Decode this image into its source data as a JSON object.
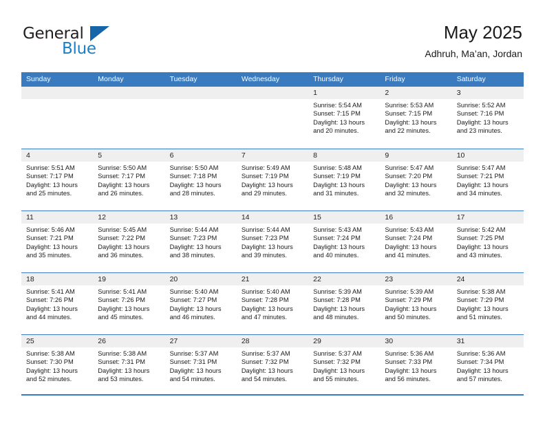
{
  "brand": {
    "name_part1": "General",
    "name_part2": "Blue",
    "flag_color": "#1565a8"
  },
  "header": {
    "title": "May 2025",
    "subtitle": "Adhruh, Ma’an, Jordan"
  },
  "theme": {
    "header_blue": "#3a7bbf",
    "date_strip_gray": "#efefef",
    "text": "#1a1a1a"
  },
  "weekdays": [
    "Sunday",
    "Monday",
    "Tuesday",
    "Wednesday",
    "Thursday",
    "Friday",
    "Saturday"
  ],
  "weeks": [
    [
      {
        "date": "",
        "lines": []
      },
      {
        "date": "",
        "lines": []
      },
      {
        "date": "",
        "lines": []
      },
      {
        "date": "",
        "lines": []
      },
      {
        "date": "1",
        "lines": [
          "Sunrise: 5:54 AM",
          "Sunset: 7:15 PM",
          "Daylight: 13 hours",
          "and 20 minutes."
        ]
      },
      {
        "date": "2",
        "lines": [
          "Sunrise: 5:53 AM",
          "Sunset: 7:15 PM",
          "Daylight: 13 hours",
          "and 22 minutes."
        ]
      },
      {
        "date": "3",
        "lines": [
          "Sunrise: 5:52 AM",
          "Sunset: 7:16 PM",
          "Daylight: 13 hours",
          "and 23 minutes."
        ]
      }
    ],
    [
      {
        "date": "4",
        "lines": [
          "Sunrise: 5:51 AM",
          "Sunset: 7:17 PM",
          "Daylight: 13 hours",
          "and 25 minutes."
        ]
      },
      {
        "date": "5",
        "lines": [
          "Sunrise: 5:50 AM",
          "Sunset: 7:17 PM",
          "Daylight: 13 hours",
          "and 26 minutes."
        ]
      },
      {
        "date": "6",
        "lines": [
          "Sunrise: 5:50 AM",
          "Sunset: 7:18 PM",
          "Daylight: 13 hours",
          "and 28 minutes."
        ]
      },
      {
        "date": "7",
        "lines": [
          "Sunrise: 5:49 AM",
          "Sunset: 7:19 PM",
          "Daylight: 13 hours",
          "and 29 minutes."
        ]
      },
      {
        "date": "8",
        "lines": [
          "Sunrise: 5:48 AM",
          "Sunset: 7:19 PM",
          "Daylight: 13 hours",
          "and 31 minutes."
        ]
      },
      {
        "date": "9",
        "lines": [
          "Sunrise: 5:47 AM",
          "Sunset: 7:20 PM",
          "Daylight: 13 hours",
          "and 32 minutes."
        ]
      },
      {
        "date": "10",
        "lines": [
          "Sunrise: 5:47 AM",
          "Sunset: 7:21 PM",
          "Daylight: 13 hours",
          "and 34 minutes."
        ]
      }
    ],
    [
      {
        "date": "11",
        "lines": [
          "Sunrise: 5:46 AM",
          "Sunset: 7:21 PM",
          "Daylight: 13 hours",
          "and 35 minutes."
        ]
      },
      {
        "date": "12",
        "lines": [
          "Sunrise: 5:45 AM",
          "Sunset: 7:22 PM",
          "Daylight: 13 hours",
          "and 36 minutes."
        ]
      },
      {
        "date": "13",
        "lines": [
          "Sunrise: 5:44 AM",
          "Sunset: 7:23 PM",
          "Daylight: 13 hours",
          "and 38 minutes."
        ]
      },
      {
        "date": "14",
        "lines": [
          "Sunrise: 5:44 AM",
          "Sunset: 7:23 PM",
          "Daylight: 13 hours",
          "and 39 minutes."
        ]
      },
      {
        "date": "15",
        "lines": [
          "Sunrise: 5:43 AM",
          "Sunset: 7:24 PM",
          "Daylight: 13 hours",
          "and 40 minutes."
        ]
      },
      {
        "date": "16",
        "lines": [
          "Sunrise: 5:43 AM",
          "Sunset: 7:24 PM",
          "Daylight: 13 hours",
          "and 41 minutes."
        ]
      },
      {
        "date": "17",
        "lines": [
          "Sunrise: 5:42 AM",
          "Sunset: 7:25 PM",
          "Daylight: 13 hours",
          "and 43 minutes."
        ]
      }
    ],
    [
      {
        "date": "18",
        "lines": [
          "Sunrise: 5:41 AM",
          "Sunset: 7:26 PM",
          "Daylight: 13 hours",
          "and 44 minutes."
        ]
      },
      {
        "date": "19",
        "lines": [
          "Sunrise: 5:41 AM",
          "Sunset: 7:26 PM",
          "Daylight: 13 hours",
          "and 45 minutes."
        ]
      },
      {
        "date": "20",
        "lines": [
          "Sunrise: 5:40 AM",
          "Sunset: 7:27 PM",
          "Daylight: 13 hours",
          "and 46 minutes."
        ]
      },
      {
        "date": "21",
        "lines": [
          "Sunrise: 5:40 AM",
          "Sunset: 7:28 PM",
          "Daylight: 13 hours",
          "and 47 minutes."
        ]
      },
      {
        "date": "22",
        "lines": [
          "Sunrise: 5:39 AM",
          "Sunset: 7:28 PM",
          "Daylight: 13 hours",
          "and 48 minutes."
        ]
      },
      {
        "date": "23",
        "lines": [
          "Sunrise: 5:39 AM",
          "Sunset: 7:29 PM",
          "Daylight: 13 hours",
          "and 50 minutes."
        ]
      },
      {
        "date": "24",
        "lines": [
          "Sunrise: 5:38 AM",
          "Sunset: 7:29 PM",
          "Daylight: 13 hours",
          "and 51 minutes."
        ]
      }
    ],
    [
      {
        "date": "25",
        "lines": [
          "Sunrise: 5:38 AM",
          "Sunset: 7:30 PM",
          "Daylight: 13 hours",
          "and 52 minutes."
        ]
      },
      {
        "date": "26",
        "lines": [
          "Sunrise: 5:38 AM",
          "Sunset: 7:31 PM",
          "Daylight: 13 hours",
          "and 53 minutes."
        ]
      },
      {
        "date": "27",
        "lines": [
          "Sunrise: 5:37 AM",
          "Sunset: 7:31 PM",
          "Daylight: 13 hours",
          "and 54 minutes."
        ]
      },
      {
        "date": "28",
        "lines": [
          "Sunrise: 5:37 AM",
          "Sunset: 7:32 PM",
          "Daylight: 13 hours",
          "and 54 minutes."
        ]
      },
      {
        "date": "29",
        "lines": [
          "Sunrise: 5:37 AM",
          "Sunset: 7:32 PM",
          "Daylight: 13 hours",
          "and 55 minutes."
        ]
      },
      {
        "date": "30",
        "lines": [
          "Sunrise: 5:36 AM",
          "Sunset: 7:33 PM",
          "Daylight: 13 hours",
          "and 56 minutes."
        ]
      },
      {
        "date": "31",
        "lines": [
          "Sunrise: 5:36 AM",
          "Sunset: 7:34 PM",
          "Daylight: 13 hours",
          "and 57 minutes."
        ]
      }
    ]
  ]
}
